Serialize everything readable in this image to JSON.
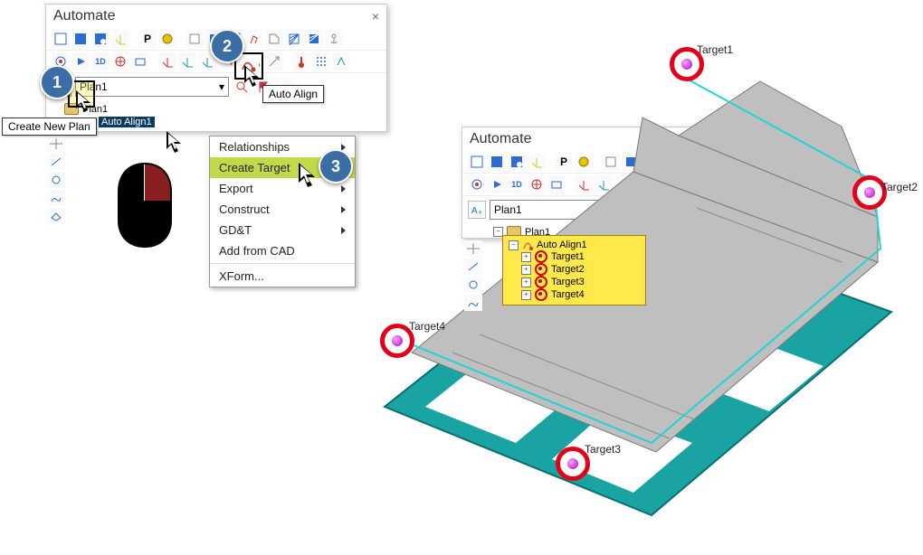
{
  "steps": {
    "one": "1",
    "two": "2",
    "three": "3"
  },
  "panelA": {
    "title": "Automate",
    "plan_select": "Plan1",
    "tree": {
      "root": "Plan1",
      "child": "Auto Align1"
    },
    "tooltip_new_plan": "Create New Plan",
    "tooltip_auto_align": "Auto Align"
  },
  "context_menu": {
    "relationships": "Relationships",
    "create_target": "Create Target",
    "export": "Export",
    "construct": "Construct",
    "gdt": "GD&T",
    "add_from_cad": "Add from CAD",
    "xform": "XForm..."
  },
  "panelB": {
    "title": "Automate",
    "plan_select": "Plan1",
    "tree": {
      "root": "Plan1",
      "align": "Auto Align1",
      "t1": "Target1",
      "t2": "Target2",
      "t3": "Target3",
      "t4": "Target4"
    }
  },
  "targets": {
    "t1": "Target1",
    "t2": "Target2",
    "t3": "Target3",
    "t4": "Target4"
  },
  "icons": {
    "plan_btn": "A+",
    "chev": "▾"
  }
}
